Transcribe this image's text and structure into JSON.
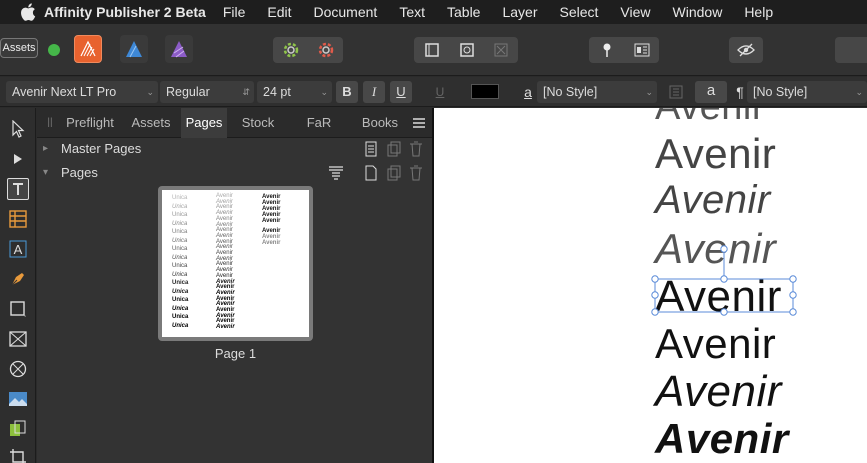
{
  "menubar": {
    "app_name": "Affinity Publisher 2 Beta",
    "items": [
      "File",
      "Edit",
      "Document",
      "Text",
      "Table",
      "Layer",
      "Select",
      "View",
      "Window",
      "Help"
    ]
  },
  "toolbar": {
    "assets_label": "Assets"
  },
  "context": {
    "font_family": "Avenir Next LT Pro",
    "font_style": "Regular",
    "font_size": "24 pt",
    "bold": "B",
    "italic": "I",
    "underline": "U",
    "char_style": "[No Style]",
    "para_style": "[No Style]",
    "char_style_icon": "a",
    "a_button": "a",
    "pilcrow": "¶"
  },
  "panel": {
    "tabs": [
      "Preflight",
      "Assets",
      "Pages",
      "Stock",
      "FaR",
      "Books"
    ],
    "active_tab": "Pages",
    "master_pages": "Master Pages",
    "pages": "Pages",
    "page1_label": "Page 1"
  },
  "thumbnail": {
    "col1": [
      "Unica",
      "Unica",
      "Unica",
      "Unica",
      "Unica",
      "Unica",
      "Unica",
      "Unica",
      "Unica",
      "Unica",
      "Unica",
      "Unica",
      "Unica",
      "Unica",
      "Unica",
      "Unica"
    ],
    "col2": [
      "Avenir",
      "Avenir",
      "Avenir",
      "Avenir",
      "Avenir",
      "Avenir",
      "Avenir",
      "Avenir",
      "Avenir",
      "Avenir",
      "Avenir",
      "Avenir",
      "Avenir",
      "Avenir",
      "Avenir",
      "Avenir",
      "Avenir",
      "Avenir",
      "Avenir",
      "Avenir",
      "Avenir",
      "Avenir",
      "Avenir",
      "Avenir"
    ],
    "col3": [
      "Avenir",
      "Avenir",
      "Avenir",
      "Avenir",
      "Avenir",
      "Avenir",
      "Avenir",
      "Avenir"
    ]
  },
  "canvas": {
    "samples": [
      "Avenir",
      "Avenir",
      "Avenir",
      "Avenir",
      "Avenir",
      "Avenir",
      "Avenir",
      "Avenir"
    ]
  },
  "colors": {
    "accent_selection": "#5b8bd8",
    "persona_publisher": "#e8622e",
    "persona_designer": "#3e88d6",
    "persona_photo": "#8c5cc8",
    "status_dot": "#45b649"
  }
}
